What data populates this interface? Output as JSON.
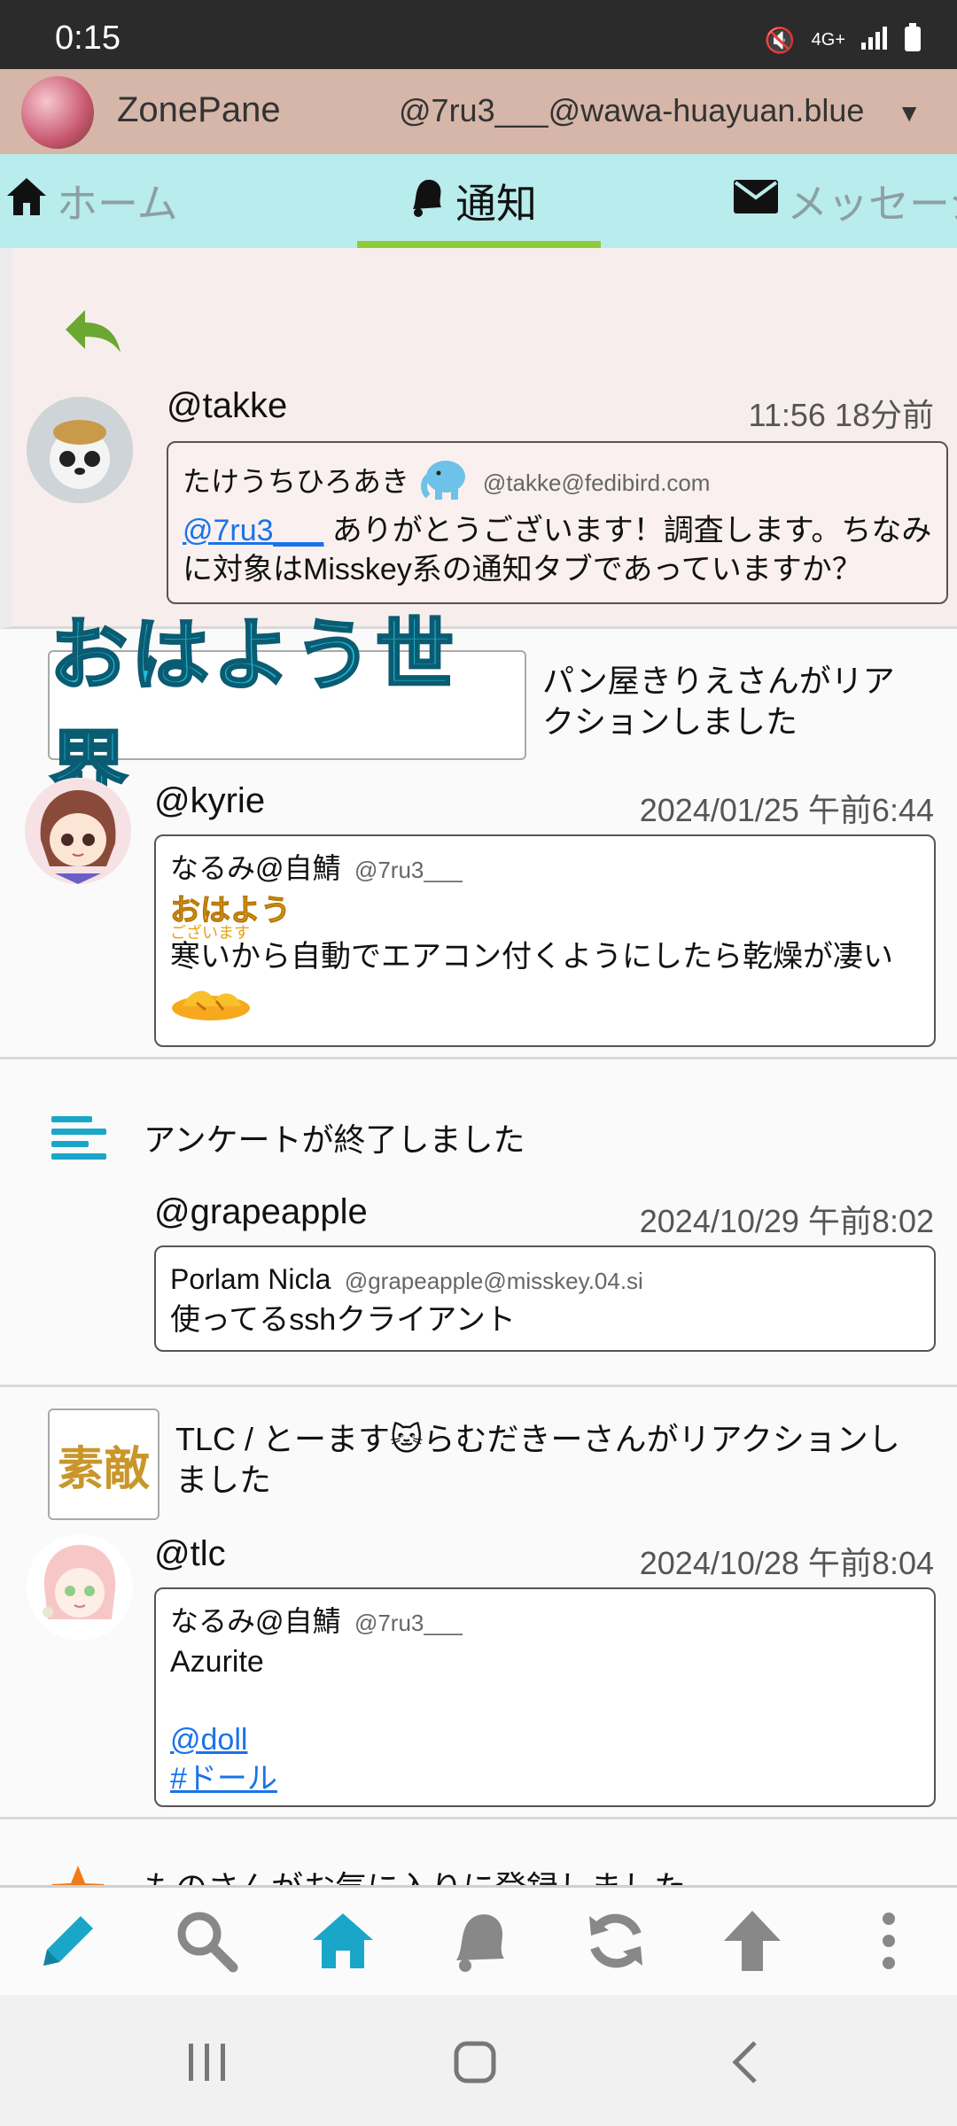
{
  "status_bar": {
    "time": "0:15",
    "network": "4G+"
  },
  "app_bar": {
    "title": "ZonePane",
    "account": "@7ru3___@wawa-huayuan.blue"
  },
  "tabs": [
    {
      "label": "ホーム",
      "icon": "home-icon"
    },
    {
      "label": "通知",
      "icon": "bell-icon",
      "active": true
    },
    {
      "label": "メッセージ",
      "icon": "mail-icon"
    }
  ],
  "notifications": {
    "n1": {
      "username": "@takke",
      "time": "11:56 18分前",
      "author": "たけうちひろあき",
      "author_acct": "@takke@fedibird.com",
      "mention": "@7ru3___",
      "text": " ありがとうございます！調査します。ちなみに対象はMisskey系の通知タブであっていますか？"
    },
    "n2": {
      "reaction_emoji": "おはよう世界",
      "reaction_text": "パン屋きりえさんがリアクションしました",
      "username": "@kyrie",
      "time": "2024/01/25 午前6:44",
      "author": "なるみ@自鯖",
      "author_acct": "@7ru3___",
      "emoji_main": "おはよう",
      "emoji_sub": "ございます",
      "text": "寒いから自動でエアコン付くようにしたら乾燥が凄い"
    },
    "n3": {
      "poll_text": "アンケートが終了しました",
      "username": "@grapeapple",
      "time": "2024/10/29 午前8:02",
      "author": "Porlam Nicla",
      "author_acct": "@grapeapple@misskey.04.si",
      "text": "使ってるsshクライアント"
    },
    "n4": {
      "reaction_emoji": "素敵",
      "reaction_text": "TLC / とーます🐱らむだきーさんがリアクションしました",
      "username": "@tlc",
      "time": "2024/10/28 午前8:04",
      "author": "なるみ@自鯖",
      "author_acct": "@7ru3___",
      "text": "Azurite",
      "link1": "@doll",
      "link2": "#ドール"
    },
    "n5": {
      "fav_text": "ものさんがお気に入りに登録しました"
    }
  },
  "colors": {
    "app_bar": "#d6b6a8",
    "tab_bar": "#b9ecec",
    "tab_indicator": "#8fcc38",
    "accent": "#1aa6c8",
    "link": "#1a73e8"
  }
}
